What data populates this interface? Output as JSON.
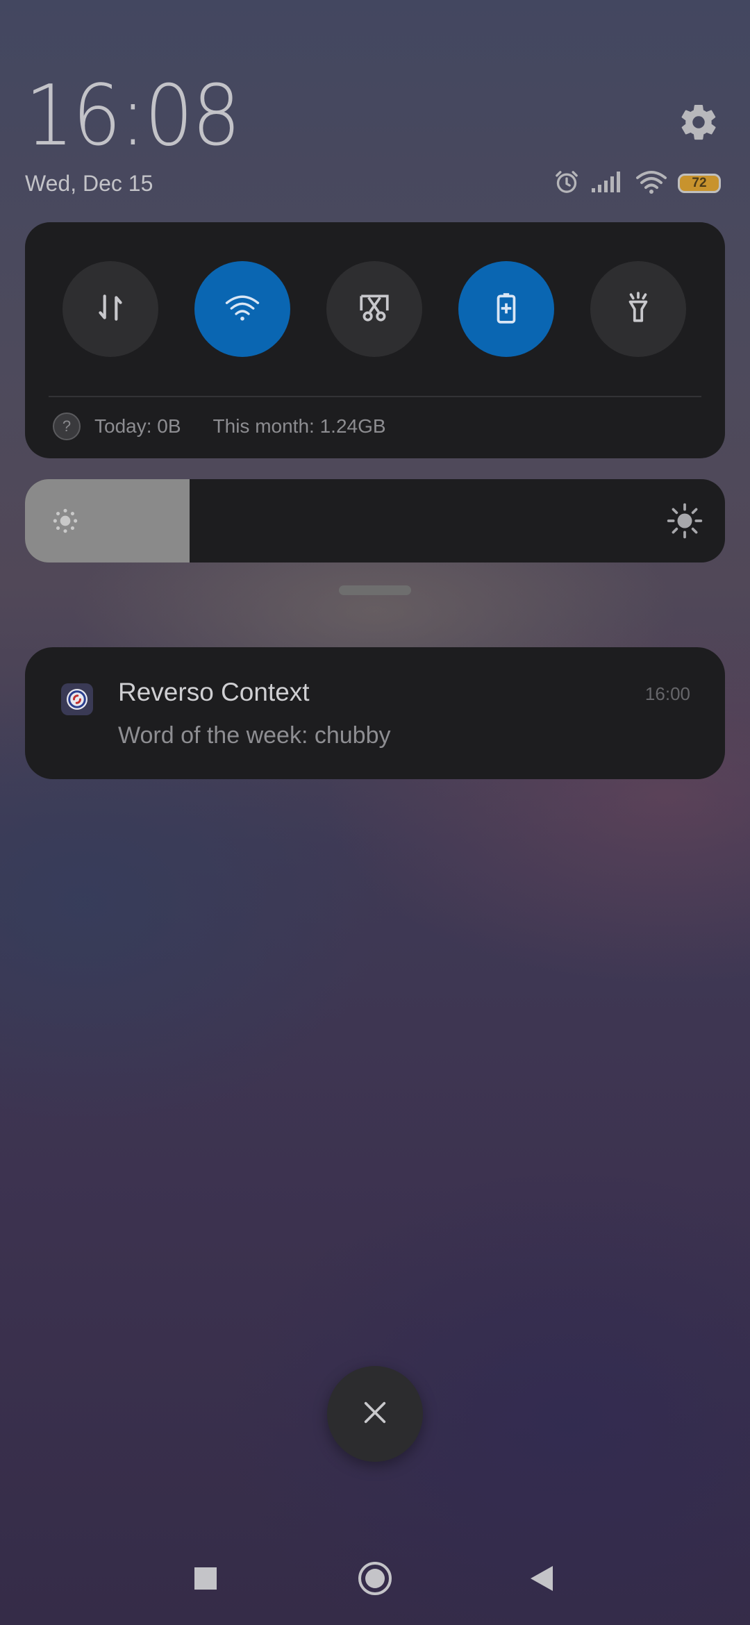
{
  "header": {
    "time": "16:08",
    "date": "Wed, Dec 15",
    "settings_icon": "gear-icon"
  },
  "status_bar": {
    "icons": [
      "alarm-icon",
      "cellular-signal-icon",
      "wifi-icon"
    ],
    "battery_level": "72",
    "battery_color": "#c8932d"
  },
  "quick_settings": {
    "toggles": [
      {
        "name": "mobile-data-toggle",
        "icon": "data-arrows-icon",
        "on": false
      },
      {
        "name": "wifi-toggle",
        "icon": "wifi-icon",
        "on": true
      },
      {
        "name": "screenshot-toggle",
        "icon": "scissors-icon",
        "on": false
      },
      {
        "name": "battery-saver-toggle",
        "icon": "battery-plus-icon",
        "on": true
      },
      {
        "name": "flashlight-toggle",
        "icon": "flashlight-icon",
        "on": false
      }
    ],
    "accent_color": "#0a66b2",
    "data_usage": {
      "today": "Today: 0B",
      "month": "This month: 1.24GB"
    }
  },
  "brightness": {
    "level": 0.235,
    "low_icon": "brightness-low-icon",
    "high_icon": "brightness-high-icon"
  },
  "notification": {
    "app_name": "Reverso Context",
    "message": "Word of the week: chubby",
    "time": "16:00",
    "icon": "reverso-app-icon"
  },
  "actions": {
    "clear_icon": "close-icon"
  },
  "navigation": {
    "buttons": [
      "recents-square-icon",
      "home-circle-icon",
      "back-triangle-icon"
    ]
  }
}
